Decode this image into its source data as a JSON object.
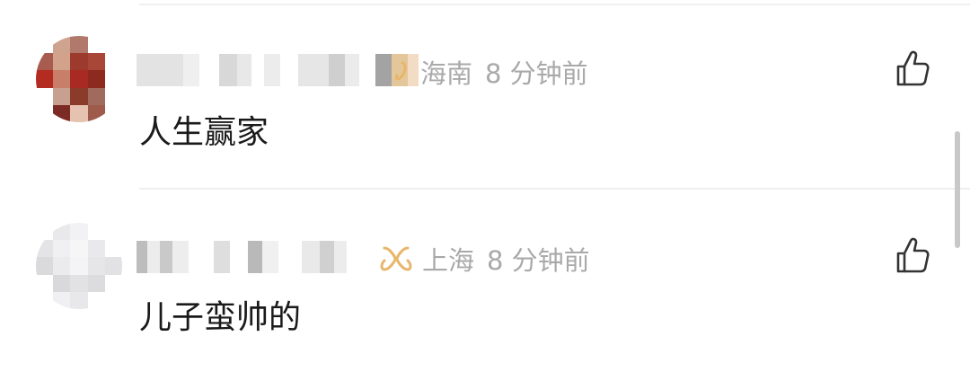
{
  "comments": [
    {
      "location": "海南",
      "time": "8 分钟前",
      "text": "人生赢家",
      "badge_icon": "heart-badge-icon",
      "avatar_colors": [
        "#ffffff",
        "#cfa48e",
        "#b0796c",
        "#ffffff",
        "#ffffff",
        "#a85c50",
        "#d2a38a",
        "#9b3a2d",
        "#a84737",
        "#ffffff",
        "#b42b22",
        "#c77f6a",
        "#a92a22",
        "#8c2a20",
        "#ffffff",
        "#ffffff",
        "#c8a08f",
        "#8a3b2a",
        "#a06a5c",
        "#ffffff",
        "#ffffff",
        "#7c2a24",
        "#e6c2b1",
        "#9e5a4a",
        "#ffffff"
      ]
    },
    {
      "location": "上海",
      "time": "8 分钟前",
      "text": "儿子蛮帅的",
      "badge_icon": "butterfly-badge-icon",
      "avatar_colors": [
        "#ffffff",
        "#e9e9ec",
        "#f2f2f4",
        "#ffffff",
        "#ffffff",
        "#e4e4e6",
        "#f0f0f2",
        "#f6f6f7",
        "#e9e9eb",
        "#ffffff",
        "#dadadd",
        "#ebebee",
        "#f4f4f6",
        "#e6e6e9",
        "#e2e2e5",
        "#ffffff",
        "#d9d9dc",
        "#e2e2e5",
        "#dcdcdf",
        "#ffffff",
        "#ffffff",
        "#f0f0f2",
        "#e8e8ea",
        "#ffffff",
        "#ffffff"
      ]
    }
  ],
  "colors": {
    "meta_text": "#a9a9a9",
    "comment_text": "#1a1a1a",
    "badge_accent": "#e8b66a",
    "divider": "#efefef",
    "icon_stroke": "#333333"
  },
  "icons": {
    "like": "thumbs-up-icon"
  }
}
